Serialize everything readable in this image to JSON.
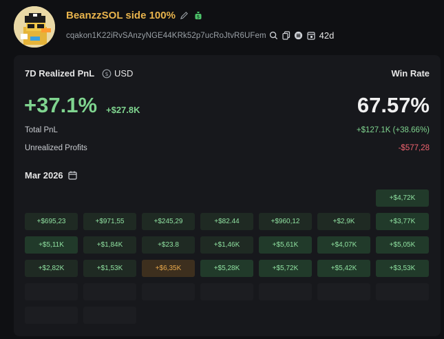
{
  "profile": {
    "name": "BeanzzSOL side 100%",
    "address": "cqakon1K22iRvSAnzyNGE44KRk52p7ucRoJtvR6UFem",
    "age": "42d"
  },
  "pnl": {
    "label": "7D Realized PnL",
    "currency": "USD",
    "percent": "+37.1%",
    "amount": "+$27.8K",
    "win_rate_label": "Win Rate",
    "win_rate": "67.57%",
    "total_label": "Total PnL",
    "total_value": "+$127.1K (+38.66%)",
    "unrealized_label": "Unrealized Profits",
    "unrealized_value": "-$577,28"
  },
  "calendar": {
    "month": "Mar 2026",
    "cells": [
      "",
      "",
      "",
      "",
      "",
      "",
      "+$4,72K",
      "+$695,23",
      "+$971,55",
      "+$245,29",
      "+$82.44",
      "+$960,12",
      "+$2,9K",
      "+$3,77K",
      "+$5,11K",
      "+$1,84K",
      "+$23.8",
      "+$1,46K",
      "+$5,61K",
      "+$4,07K",
      "+$5,05K",
      "+$2,82K",
      "+$1,53K",
      "+$6,35K",
      "+$5,28K",
      "+$5,72K",
      "+$5,42K",
      "+$3,53K",
      "",
      "",
      "",
      "",
      "",
      "",
      "",
      "",
      ""
    ]
  },
  "colors": {
    "accent_gold": "#e9b44c",
    "positive": "#7fd48f",
    "negative": "#f0636f"
  }
}
